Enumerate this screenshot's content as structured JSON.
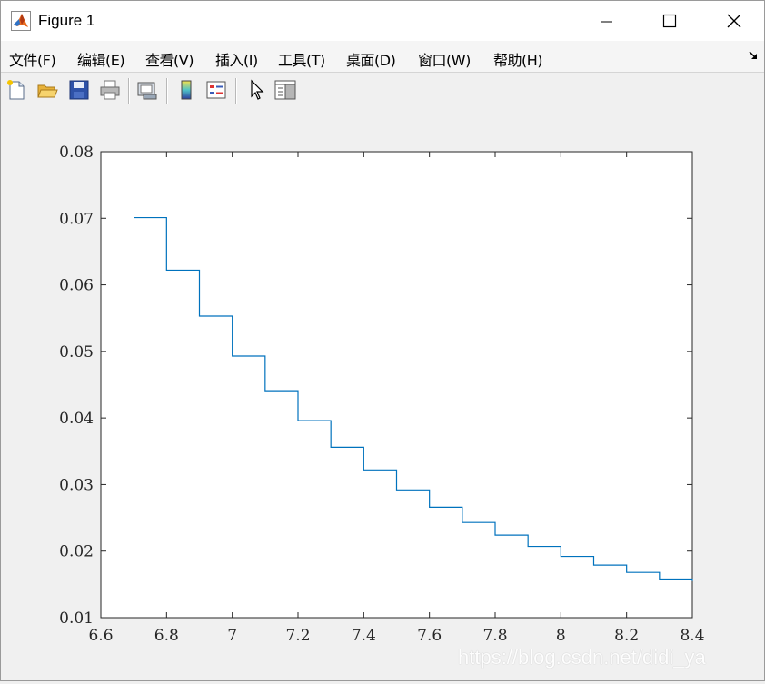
{
  "window": {
    "title": "Figure 1",
    "icons": {
      "app": "matlab-logo-icon",
      "minimize": "minimize-icon",
      "maximize": "maximize-icon",
      "close": "close-icon"
    }
  },
  "menubar": {
    "items": [
      {
        "label": "文件(F)"
      },
      {
        "label": "编辑(E)"
      },
      {
        "label": "查看(V)"
      },
      {
        "label": "插入(I)"
      },
      {
        "label": "工具(T)"
      },
      {
        "label": "桌面(D)"
      },
      {
        "label": "窗口(W)"
      },
      {
        "label": "帮助(H)"
      }
    ],
    "dock_icon": "dock-arrow-icon"
  },
  "toolbar": {
    "buttons": [
      {
        "icon": "new-figure-icon"
      },
      {
        "icon": "open-file-icon"
      },
      {
        "icon": "save-icon"
      },
      {
        "icon": "print-icon"
      },
      {
        "icon": "link-plot-icon"
      },
      {
        "icon": "insert-colorbar-icon"
      },
      {
        "icon": "insert-legend-icon"
      },
      {
        "icon": "edit-plot-arrow-icon"
      },
      {
        "icon": "property-inspector-icon"
      }
    ]
  },
  "chart_data": {
    "type": "line",
    "style": "stairs",
    "title": "",
    "xlabel": "",
    "ylabel": "",
    "xlim": [
      6.6,
      8.4
    ],
    "ylim": [
      0.01,
      0.08
    ],
    "xticks": [
      "6.6",
      "6.8",
      "7",
      "7.2",
      "7.4",
      "7.6",
      "7.8",
      "8",
      "8.2",
      "8.4"
    ],
    "yticks": [
      "0.01",
      "0.02",
      "0.03",
      "0.04",
      "0.05",
      "0.06",
      "0.07",
      "0.08"
    ],
    "grid": false,
    "line_color": "#0072bd",
    "series": [
      {
        "x": [
          6.7,
          6.8,
          6.9,
          7.0,
          7.1,
          7.2,
          7.3,
          7.4,
          7.5,
          7.6,
          7.7,
          7.8,
          7.9,
          8.0,
          8.1,
          8.2,
          8.3,
          8.4
        ],
        "values": [
          0.0701,
          0.0622,
          0.0553,
          0.0493,
          0.0441,
          0.0396,
          0.0356,
          0.0322,
          0.0292,
          0.0266,
          0.0243,
          0.0224,
          0.0207,
          0.0192,
          0.0179,
          0.0168,
          0.0158,
          0.0155
        ]
      }
    ]
  },
  "watermark": "https://blog.csdn.net/didi_ya"
}
